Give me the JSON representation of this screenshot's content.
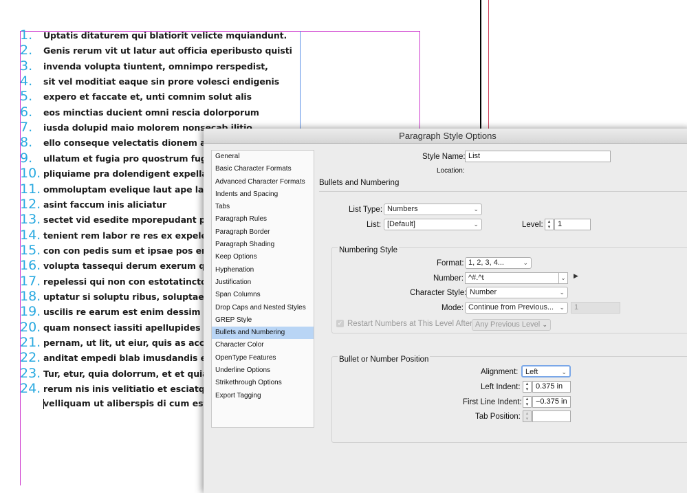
{
  "document": {
    "list_items": [
      {
        "num": "1.",
        "text": "Uptatis ditaturem qui blatiorit velicte mquiandunt."
      },
      {
        "num": "2.",
        "text": "Genis rerum vit ut latur aut officia eperibusto quisti"
      },
      {
        "num": "3.",
        "text": "invenda volupta tiuntent, omnimpo rerspedist,"
      },
      {
        "num": "4.",
        "text": "sit vel moditiat eaque sin prore volesci endigenis"
      },
      {
        "num": "5.",
        "text": "expero et faccate et, unti comnim solut alis"
      },
      {
        "num": "6.",
        "text": "eos minctias ducient omni rescia dolorporum"
      },
      {
        "num": "7.",
        "text": "iusda dolupid maio molorem nonsecab ilitio"
      },
      {
        "num": "8.",
        "text": "ello conseque velectatis dionem auditatur"
      },
      {
        "num": "9.",
        "text": "ullatum et fugia pro quostrum fuga. Alisto"
      },
      {
        "num": "10.",
        "text": "pliquiame pra dolendigent expella ndende"
      },
      {
        "num": "11.",
        "text": "ommoluptam evelique laut ape laut"
      },
      {
        "num": "12.",
        "text": "asint faccum inis aliciatur"
      },
      {
        "num": "13.",
        "text": "sectet vid esedite mporepudant perspie nt"
      },
      {
        "num": "14.",
        "text": "tenient rem labor re res ex expeles et ut vo"
      },
      {
        "num": "15.",
        "text": "con con pedis sum et ipsae pos endelicia v"
      },
      {
        "num": "16.",
        "text": "volupta tassequi derum exerum quaerum"
      },
      {
        "num": "17.",
        "text": "repelessi qui non con estotatincto incimol"
      },
      {
        "num": "18.",
        "text": "uptatur si soluptu ribus, soluptae net volu"
      },
      {
        "num": "19.",
        "text": "uscilis re earum est enim dessim quia"
      },
      {
        "num": "20.",
        "text": "quam nonsect iassiti apellupides eaque ei"
      },
      {
        "num": "21.",
        "text": "pernam, ut lit, ut eiur, quis as accuptur sim"
      },
      {
        "num": "22.",
        "text": "anditat empedi blab imusdandis es eost, e"
      },
      {
        "num": "23.",
        "text": "Tur, etur, quia dolorrum, et et quiae con re"
      },
      {
        "num": "24.",
        "text": "rerum nis inis velitiatio et esciatquam quis"
      }
    ],
    "continuation_line": "velliquam ut aliberspis di cum est a dis atq",
    "number_color": "#29a9e0",
    "frame_color": "#cc33cc",
    "column_guide_color": "#5b8fe6"
  },
  "dialog": {
    "title": "Paragraph Style Options",
    "categories": [
      "General",
      "Basic Character Formats",
      "Advanced Character Formats",
      "Indents and Spacing",
      "Tabs",
      "Paragraph Rules",
      "Paragraph Border",
      "Paragraph Shading",
      "Keep Options",
      "Hyphenation",
      "Justification",
      "Span Columns",
      "Drop Caps and Nested Styles",
      "GREP Style",
      "Bullets and Numbering",
      "Character Color",
      "OpenType Features",
      "Underline Options",
      "Strikethrough Options",
      "Export Tagging"
    ],
    "selected_category": "Bullets and Numbering",
    "style_name_label": "Style Name:",
    "style_name_value": "List",
    "location_label": "Location:",
    "section_title": "Bullets and Numbering",
    "list_type_label": "List Type:",
    "list_type_value": "Numbers",
    "list_label": "List:",
    "list_value": "[Default]",
    "level_label": "Level:",
    "level_value": "1",
    "numbering_style": {
      "title": "Numbering Style",
      "format_label": "Format:",
      "format_value": "1, 2, 3, 4...",
      "number_label": "Number:",
      "number_value": "^#.^t",
      "char_style_label": "Character Style:",
      "char_style_value": "Number",
      "mode_label": "Mode:",
      "mode_value": "Continue from Previous...",
      "mode_number": "1",
      "restart_label": "Restart Numbers at This Level After:",
      "restart_value": "Any Previous Level"
    },
    "position": {
      "title": "Bullet or Number Position",
      "alignment_label": "Alignment:",
      "alignment_value": "Left",
      "left_indent_label": "Left Indent:",
      "left_indent_value": "0.375 in",
      "first_line_label": "First Line Indent:",
      "first_line_value": "−0.375 in",
      "tab_position_label": "Tab Position:",
      "tab_position_value": ""
    }
  }
}
